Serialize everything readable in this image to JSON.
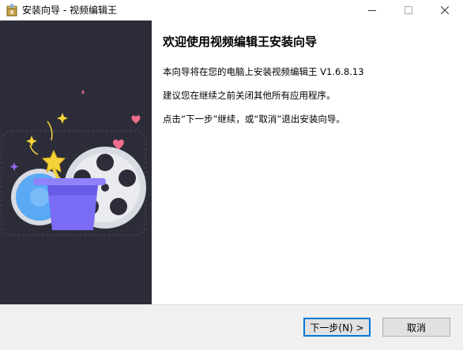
{
  "window": {
    "title": "安装向导 - 视频编辑王",
    "icons": {
      "app": "installer-box-icon",
      "minimize": "minimize-icon",
      "maximize": "maximize-icon",
      "close": "close-icon"
    }
  },
  "content": {
    "heading": "欢迎使用视频编辑王安装向导",
    "line1": "本向导将在您的电脑上安装视频编辑王 V1.6.8.13",
    "line2": "建议您在继续之前关闭其他所有应用程序。",
    "line3": "点击“下一步”继续，或“取消”退出安装向导。"
  },
  "buttons": {
    "next": "下一步(N) >",
    "cancel": "取消"
  },
  "colors": {
    "sidebar": "#2c2d38",
    "accent": "#0078d7",
    "hat": "#7b6cf6",
    "reel_blue": "#5aa9f5",
    "star": "#f5d33a",
    "heart": "#f06b8d"
  }
}
